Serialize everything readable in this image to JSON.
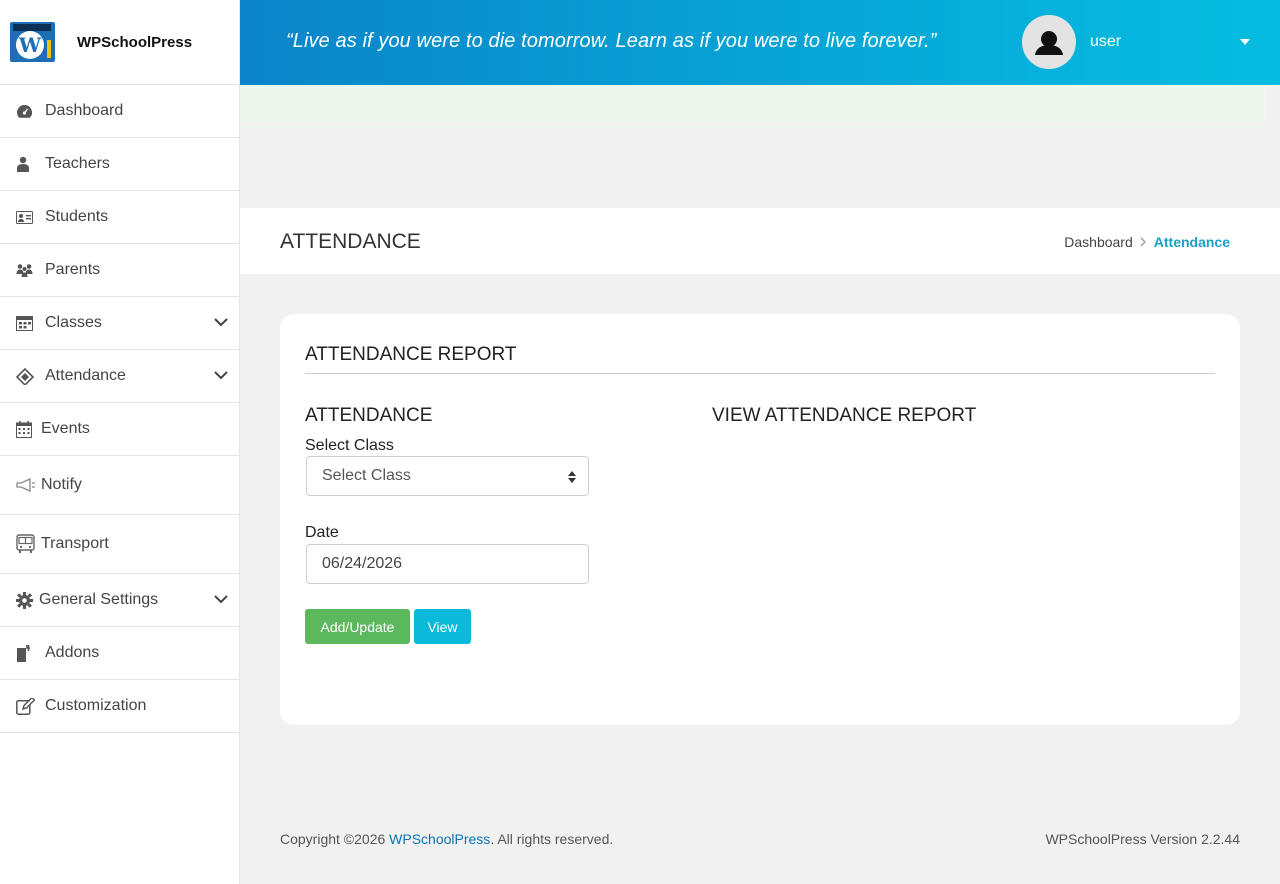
{
  "brand": {
    "name": "WPSchoolPress"
  },
  "sidebar": {
    "items": [
      {
        "label": "Dashboard",
        "icon": "dashboard-icon"
      },
      {
        "label": "Teachers",
        "icon": "teacher-icon"
      },
      {
        "label": "Students",
        "icon": "student-card-icon"
      },
      {
        "label": "Parents",
        "icon": "parents-icon"
      },
      {
        "label": "Classes",
        "icon": "classes-icon",
        "expandable": true
      },
      {
        "label": "Attendance",
        "icon": "attendance-icon",
        "expandable": true
      },
      {
        "label": "Events",
        "icon": "calendar-icon"
      },
      {
        "label": "Notify",
        "icon": "megaphone-icon"
      },
      {
        "label": "Transport",
        "icon": "bus-icon"
      },
      {
        "label": "General Settings",
        "icon": "gear-icon",
        "expandable": true
      },
      {
        "label": "Addons",
        "icon": "addons-icon"
      },
      {
        "label": "Customization",
        "icon": "edit-icon"
      }
    ]
  },
  "header": {
    "quote": "“Live as if you were to die tomorrow. Learn as if you were to live forever.”",
    "user": "user"
  },
  "page": {
    "title": "ATTENDANCE",
    "breadcrumb": {
      "home": "Dashboard",
      "current": "Attendance"
    }
  },
  "card": {
    "title": "ATTENDANCE REPORT",
    "left_title": "ATTENDANCE",
    "right_title": "VIEW ATTENDANCE REPORT",
    "class_label": "Select Class",
    "class_value": "Select Class",
    "date_label": "Date",
    "date_value": "06/24/2026",
    "add_button": "Add/Update",
    "view_button": "View"
  },
  "footer": {
    "copyright_prefix": "Copyright ©2026 ",
    "copyright_link": "WPSchoolPress",
    "copyright_suffix": ". All rights reserved.",
    "version": "WPSchoolPress Version 2.2.44"
  },
  "colors": {
    "header_start": "#0b84c9",
    "header_end": "#05bde0",
    "accent": "#17a2c9",
    "button_green": "#5cb85c",
    "button_cyan": "#0bbad9"
  }
}
